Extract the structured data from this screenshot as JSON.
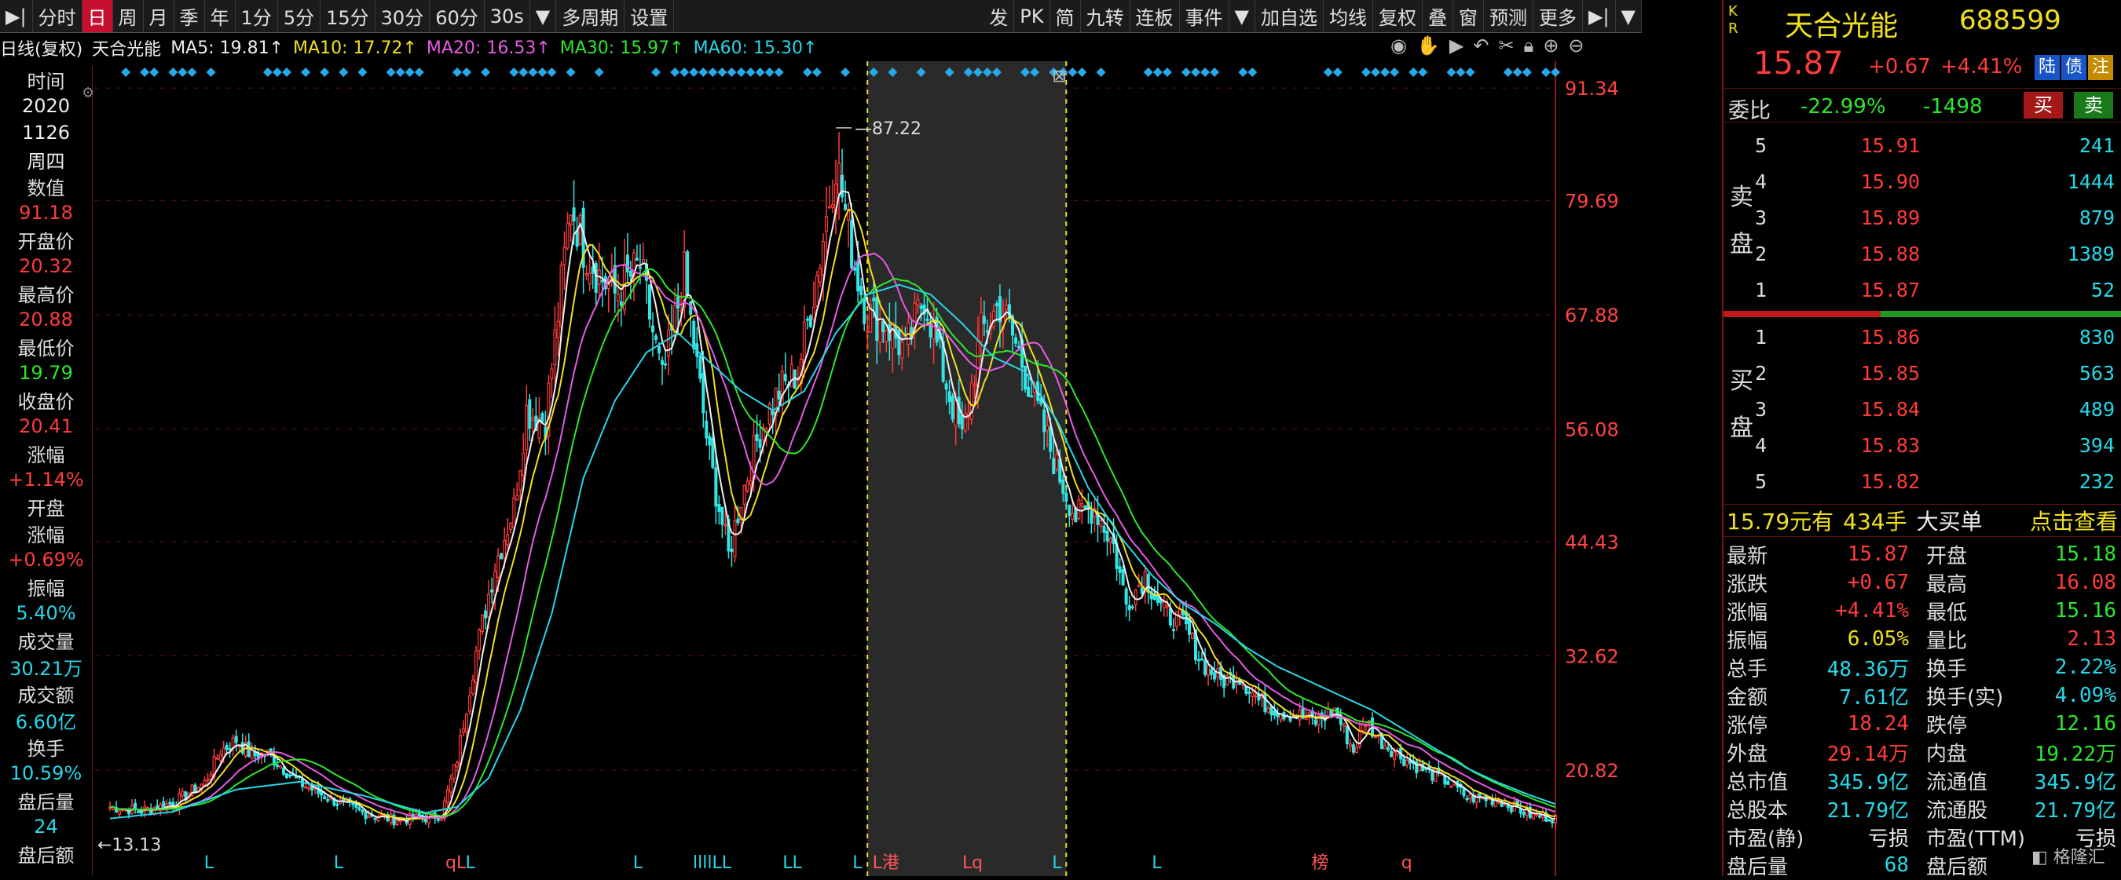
{
  "toolbar": {
    "left": [
      "分时",
      "日",
      "周",
      "月",
      "季",
      "年",
      "1分",
      "5分",
      "15分",
      "30分",
      "60分",
      "30s",
      "▼",
      "多周期",
      "设置"
    ],
    "right": [
      "发",
      "PK",
      "简",
      "九转",
      "连板",
      "事件",
      "▼",
      "加自选",
      "均线",
      "复权",
      "叠",
      "窗",
      "预测",
      "更多"
    ]
  },
  "infoline": {
    "period": "日线(复权)",
    "name": "天合光能",
    "ma5": "MA5: 19.81↑",
    "ma10": "MA10: 17.72↑",
    "ma20": "MA20: 16.53↑",
    "ma30": "MA30: 15.97↑",
    "ma60": "MA60: 15.30↑"
  },
  "leftcol": [
    {
      "t": "时间",
      "c": "lab"
    },
    {
      "t": "2020",
      "c": "white"
    },
    {
      "t": "1126",
      "c": "white"
    },
    {
      "t": "周四",
      "c": "white"
    },
    {
      "t": "数值",
      "c": "lab"
    },
    {
      "t": "91.18",
      "c": "red"
    },
    {
      "t": "开盘价",
      "c": "lab"
    },
    {
      "t": "20.32",
      "c": "red"
    },
    {
      "t": "最高价",
      "c": "lab"
    },
    {
      "t": "20.88",
      "c": "red"
    },
    {
      "t": "最低价",
      "c": "lab"
    },
    {
      "t": "19.79",
      "c": "green"
    },
    {
      "t": "收盘价",
      "c": "lab"
    },
    {
      "t": "20.41",
      "c": "red"
    },
    {
      "t": "涨幅",
      "c": "lab"
    },
    {
      "t": "+1.14%",
      "c": "red"
    },
    {
      "t": "开盘",
      "c": "lab"
    },
    {
      "t": "涨幅",
      "c": "lab"
    },
    {
      "t": "+0.69%",
      "c": "red"
    },
    {
      "t": "振幅",
      "c": "lab"
    },
    {
      "t": "5.40%",
      "c": "cyan"
    },
    {
      "t": "成交量",
      "c": "lab"
    },
    {
      "t": "30.21万",
      "c": "cyan"
    },
    {
      "t": "成交额",
      "c": "lab"
    },
    {
      "t": "6.60亿",
      "c": "cyan"
    },
    {
      "t": "换手",
      "c": "lab"
    },
    {
      "t": "10.59%",
      "c": "cyan"
    },
    {
      "t": "盘后量",
      "c": "lab"
    },
    {
      "t": "24",
      "c": "cyan"
    },
    {
      "t": "盘后额",
      "c": "lab"
    }
  ],
  "chart_data": {
    "type": "candlestick",
    "y_ticks": [
      "91.34",
      "79.69",
      "67.88",
      "56.08",
      "44.43",
      "32.62",
      "20.82"
    ],
    "y_tick_values": [
      91.34,
      79.69,
      67.88,
      56.08,
      44.43,
      32.62,
      20.82
    ],
    "ylim": [
      10.5,
      93.3
    ],
    "annotations": {
      "high": "87.22",
      "low": "13.13"
    },
    "markers": [
      "L",
      "L",
      "qL",
      "L",
      "L",
      "llllLL",
      "LL",
      "L",
      "L港",
      "Lq",
      "L",
      "L",
      "榜",
      "q"
    ],
    "colors": {
      "up": "#ff3b3b",
      "down": "#33e6e6",
      "ma5": "#f0f0f0",
      "ma10": "#f0e020",
      "ma20": "#e65ce6",
      "ma30": "#2ee62e",
      "ma60": "#27d7e8"
    },
    "close_path": [
      [
        0,
        17
      ],
      [
        10,
        16.6
      ],
      [
        20,
        17.4
      ],
      [
        30,
        19.5
      ],
      [
        35,
        22.8
      ],
      [
        40,
        23.9
      ],
      [
        45,
        22.3
      ],
      [
        50,
        22.5
      ],
      [
        60,
        19.5
      ],
      [
        70,
        17.8
      ],
      [
        80,
        16.4
      ],
      [
        90,
        15.7
      ],
      [
        100,
        15.9
      ],
      [
        105,
        16.2
      ],
      [
        110,
        22
      ],
      [
        116,
        33
      ],
      [
        122,
        42
      ],
      [
        128,
        48
      ],
      [
        132,
        58
      ],
      [
        138,
        57
      ],
      [
        142,
        68
      ],
      [
        146,
        79.5
      ],
      [
        150,
        75
      ],
      [
        155,
        72
      ],
      [
        160,
        70
      ],
      [
        168,
        73
      ],
      [
        175,
        61
      ],
      [
        182,
        72
      ],
      [
        190,
        53
      ],
      [
        196,
        43
      ],
      [
        200,
        49
      ],
      [
        206,
        56
      ],
      [
        212,
        60
      ],
      [
        218,
        62
      ],
      [
        224,
        72
      ],
      [
        230,
        84
      ],
      [
        236,
        73
      ],
      [
        240,
        68
      ],
      [
        246,
        67
      ],
      [
        252,
        64
      ],
      [
        258,
        70
      ],
      [
        264,
        62
      ],
      [
        270,
        55
      ],
      [
        276,
        66
      ],
      [
        282,
        69
      ],
      [
        288,
        64
      ],
      [
        294,
        58
      ],
      [
        300,
        52
      ],
      [
        306,
        47
      ],
      [
        312,
        48
      ],
      [
        318,
        44
      ],
      [
        322,
        38
      ],
      [
        328,
        41
      ],
      [
        334,
        37
      ],
      [
        340,
        36
      ],
      [
        346,
        32
      ],
      [
        352,
        30
      ],
      [
        358,
        30.5
      ],
      [
        364,
        28
      ],
      [
        370,
        27
      ],
      [
        376,
        26.5
      ],
      [
        382,
        25.8
      ],
      [
        388,
        27
      ],
      [
        394,
        22.8
      ],
      [
        398,
        26
      ],
      [
        402,
        24
      ],
      [
        410,
        22
      ],
      [
        418,
        20.5
      ],
      [
        424,
        19.6
      ],
      [
        430,
        18
      ],
      [
        440,
        17.7
      ],
      [
        450,
        16.2
      ],
      [
        458,
        15.87
      ]
    ],
    "ma60_path": [
      [
        0,
        15.8
      ],
      [
        20,
        16.5
      ],
      [
        40,
        18.8
      ],
      [
        60,
        19.6
      ],
      [
        80,
        18.2
      ],
      [
        100,
        16.4
      ],
      [
        110,
        17
      ],
      [
        120,
        20
      ],
      [
        130,
        27
      ],
      [
        140,
        37
      ],
      [
        150,
        51
      ],
      [
        160,
        59
      ],
      [
        170,
        64
      ],
      [
        180,
        66
      ],
      [
        190,
        63
      ],
      [
        200,
        60
      ],
      [
        210,
        58
      ],
      [
        220,
        60
      ],
      [
        230,
        66
      ],
      [
        240,
        70
      ],
      [
        250,
        71
      ],
      [
        260,
        70
      ],
      [
        270,
        67
      ],
      [
        280,
        63.5
      ],
      [
        290,
        62
      ],
      [
        300,
        57
      ],
      [
        310,
        50
      ],
      [
        320,
        45
      ],
      [
        330,
        41
      ],
      [
        340,
        38
      ],
      [
        350,
        36
      ],
      [
        360,
        33.5
      ],
      [
        370,
        31.5
      ],
      [
        380,
        30
      ],
      [
        390,
        28.5
      ],
      [
        400,
        27
      ],
      [
        410,
        25
      ],
      [
        420,
        23
      ],
      [
        430,
        21
      ],
      [
        440,
        19.5
      ],
      [
        450,
        18.2
      ],
      [
        458,
        17.3
      ]
    ]
  },
  "rp": {
    "kr": "K\nR",
    "name": "天合光能",
    "code": "688599",
    "price": "15.87",
    "chg": "+0.67",
    "pct": "+4.41%",
    "tags": [
      "陆",
      "债",
      "注"
    ],
    "wb_label": "委比",
    "wb_pct": "-22.99%",
    "wb_num": "-1498",
    "buy_btn": "买",
    "sell_btn": "卖",
    "sell_label": [
      "卖",
      "盘"
    ],
    "buy_label": [
      "买",
      "盘"
    ],
    "sells": [
      {
        "i": "5",
        "p": "15.91",
        "v": "241"
      },
      {
        "i": "4",
        "p": "15.90",
        "v": "1444"
      },
      {
        "i": "3",
        "p": "15.89",
        "v": "879"
      },
      {
        "i": "2",
        "p": "15.88",
        "v": "1389"
      },
      {
        "i": "1",
        "p": "15.87",
        "v": "52"
      }
    ],
    "buys": [
      {
        "i": "1",
        "p": "15.86",
        "v": "830"
      },
      {
        "i": "2",
        "p": "15.85",
        "v": "563"
      },
      {
        "i": "3",
        "p": "15.84",
        "v": "489"
      },
      {
        "i": "4",
        "p": "15.83",
        "v": "394"
      },
      {
        "i": "5",
        "p": "15.82",
        "v": "232"
      }
    ],
    "bigbuy": {
      "price": "15.79元有",
      "qty": "434手",
      "label": "大买单",
      "link": "点击查看"
    },
    "stats": [
      {
        "k": "最新",
        "v": "15.87",
        "c": "red",
        "k2": "开盘",
        "v2": "15.18",
        "c2": "green"
      },
      {
        "k": "涨跌",
        "v": "+0.67",
        "c": "red",
        "k2": "最高",
        "v2": "16.08",
        "c2": "red"
      },
      {
        "k": "涨幅",
        "v": "+4.41%",
        "c": "red",
        "k2": "最低",
        "v2": "15.16",
        "c2": "green"
      },
      {
        "k": "振幅",
        "v": "6.05%",
        "c": "yellow",
        "k2": "量比",
        "v2": "2.13",
        "c2": "red"
      },
      {
        "k": "总手",
        "v": "48.36万",
        "c": "cyan",
        "k2": "换手",
        "v2": "2.22%",
        "c2": "cyan"
      },
      {
        "k": "金额",
        "v": "7.61亿",
        "c": "cyan",
        "k2": "换手(实)",
        "v2": "4.09%",
        "c2": "cyan"
      },
      {
        "k": "涨停",
        "v": "18.24",
        "c": "red",
        "k2": "跌停",
        "v2": "12.16",
        "c2": "green"
      },
      {
        "k": "外盘",
        "v": "29.14万",
        "c": "red",
        "k2": "内盘",
        "v2": "19.22万",
        "c2": "green"
      },
      {
        "k": "总市值",
        "v": "345.9亿",
        "c": "cyan",
        "k2": "流通值",
        "v2": "345.9亿",
        "c2": "cyan"
      },
      {
        "k": "总股本",
        "v": "21.79亿",
        "c": "cyan",
        "k2": "流通股",
        "v2": "21.79亿",
        "c2": "cyan"
      },
      {
        "k": "市盈(静)",
        "v": "亏损",
        "c": "white",
        "k2": "市盈(TTM)",
        "v2": "亏损",
        "c2": "white"
      },
      {
        "k": "盘后量",
        "v": "68",
        "c": "cyan",
        "k2": "盘后额",
        "v2": "",
        "c2": "cyan"
      }
    ]
  }
}
